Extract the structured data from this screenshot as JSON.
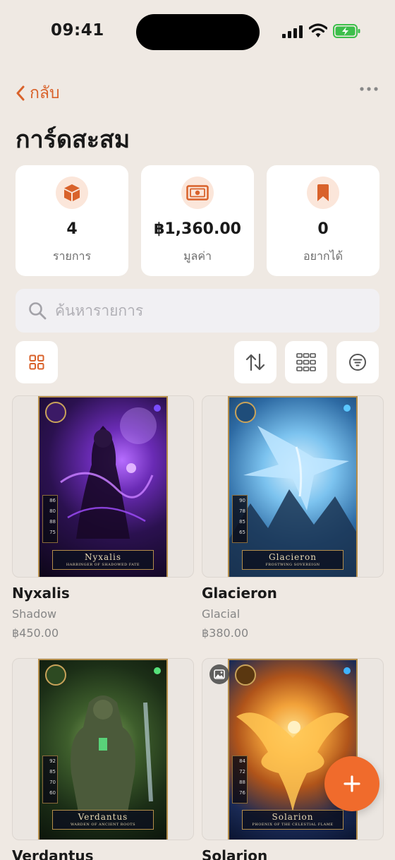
{
  "status_bar": {
    "time": "09:41"
  },
  "nav": {
    "back_label": "กลับ"
  },
  "page": {
    "title": "การ์ดสะสม"
  },
  "stats": [
    {
      "icon": "box-icon",
      "value": "4",
      "label": "รายการ"
    },
    {
      "icon": "banknote-icon",
      "value": "฿1,360.00",
      "label": "มูลค่า"
    },
    {
      "icon": "bookmark-icon",
      "value": "0",
      "label": "อยากได้"
    }
  ],
  "search": {
    "placeholder": "ค้นหารายการ",
    "value": ""
  },
  "toolbar": {
    "view_toggle_icon": "grid-icon",
    "sort_icon": "sort-arrows-icon",
    "layout_icon": "grid-compact-icon",
    "filter_icon": "filter-icon"
  },
  "items": [
    {
      "name": "Nyxalis",
      "type": "Shadow",
      "price": "฿450.00",
      "card_title": "Nyxalis",
      "card_subtitle": "HARBINGER OF SHADOWED FATE",
      "card_stats": [
        "86",
        "80",
        "88",
        "75"
      ]
    },
    {
      "name": "Glacieron",
      "type": "Glacial",
      "price": "฿380.00",
      "card_title": "Glacieron",
      "card_subtitle": "FROSTWING SOVEREIGN",
      "card_stats": [
        "90",
        "78",
        "85",
        "65"
      ]
    },
    {
      "name": "Verdantus",
      "type": "",
      "price": "",
      "card_title": "Verdantus",
      "card_subtitle": "WARDEN OF ANCIENT ROOTS",
      "card_stats": [
        "92",
        "85",
        "70",
        "60"
      ]
    },
    {
      "name": "Solarion",
      "type": "",
      "price": "",
      "card_title": "Solarion",
      "card_subtitle": "PHOENIX OF THE CELESTIAL FLAME",
      "card_stats": [
        "84",
        "72",
        "88",
        "76"
      ]
    }
  ],
  "colors": {
    "accent": "#d9622b",
    "fab": "#f06b2c",
    "background": "#efe9e3"
  }
}
